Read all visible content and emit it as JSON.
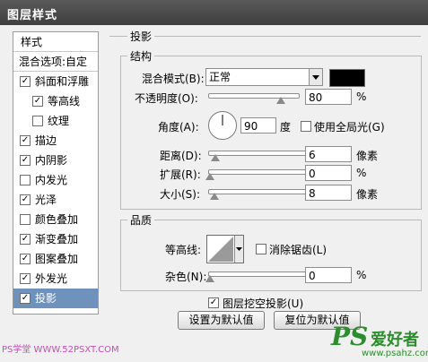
{
  "window": {
    "title": "图层样式"
  },
  "styles_panel": {
    "header": "样式",
    "blend_options": "混合选项:自定",
    "items": [
      {
        "label": "斜面和浮雕",
        "checked": true,
        "indent": false
      },
      {
        "label": "等高线",
        "checked": true,
        "indent": true
      },
      {
        "label": "纹理",
        "checked": false,
        "indent": true
      },
      {
        "label": "描边",
        "checked": true,
        "indent": false
      },
      {
        "label": "内阴影",
        "checked": true,
        "indent": false
      },
      {
        "label": "内发光",
        "checked": false,
        "indent": false
      },
      {
        "label": "光泽",
        "checked": true,
        "indent": false
      },
      {
        "label": "颜色叠加",
        "checked": false,
        "indent": false
      },
      {
        "label": "渐变叠加",
        "checked": true,
        "indent": false
      },
      {
        "label": "图案叠加",
        "checked": true,
        "indent": false
      },
      {
        "label": "外发光",
        "checked": true,
        "indent": false
      },
      {
        "label": "投影",
        "checked": true,
        "indent": false,
        "selected": true
      }
    ]
  },
  "shadow": {
    "section_title": "投影",
    "structure": {
      "title": "结构",
      "blend_mode_label": "混合模式(B):",
      "blend_mode_value": "正常",
      "blend_color": "#000000",
      "opacity_label": "不透明度(O):",
      "opacity_value": "80",
      "opacity_unit": "%",
      "opacity_fraction": 0.8,
      "angle_label": "角度(A):",
      "angle_value": "90",
      "angle_unit": "度",
      "global_light_label": "使用全局光(G)",
      "global_light_checked": false,
      "distance_label": "距离(D):",
      "distance_value": "6",
      "distance_unit": "像素",
      "spread_label": "扩展(R):",
      "spread_value": "0",
      "spread_unit": "%",
      "size_label": "大小(S):",
      "size_value": "8",
      "size_unit": "像素"
    },
    "quality": {
      "title": "品质",
      "contour_label": "等高线:",
      "antialias_label": "消除锯齿(L)",
      "antialias_checked": false,
      "noise_label": "杂色(N):",
      "noise_value": "0",
      "noise_unit": "%"
    },
    "knockout_label": "图层挖空投影(U)",
    "knockout_checked": true,
    "set_default_label": "设置为默认值",
    "reset_default_label": "复位为默认值"
  },
  "watermarks": {
    "left": "PS学堂 WWW.52PSXT.COM",
    "logo_main": "PS",
    "logo_cn": "爱好者",
    "logo_url": "www.psahz.com"
  }
}
